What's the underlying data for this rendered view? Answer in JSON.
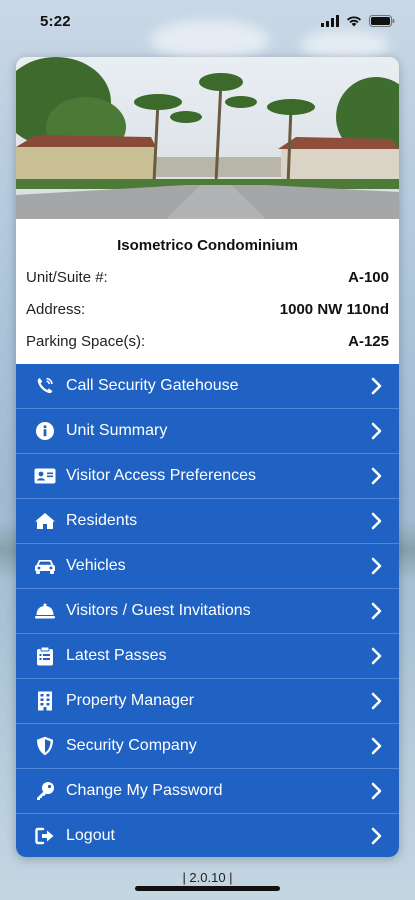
{
  "status_bar": {
    "time": "5:22"
  },
  "property": {
    "name": "Isometrico Condominium",
    "rows": [
      {
        "label": "Unit/Suite #:",
        "value": "A-100"
      },
      {
        "label": "Address:",
        "value": "1000 NW 110nd"
      },
      {
        "label": "Parking Space(s):",
        "value": "A-125"
      }
    ]
  },
  "menu": {
    "items": [
      {
        "label": "Call Security Gatehouse",
        "icon": "phone-icon"
      },
      {
        "label": "Unit Summary",
        "icon": "info-icon"
      },
      {
        "label": "Visitor Access Preferences",
        "icon": "id-card-icon"
      },
      {
        "label": "Residents",
        "icon": "home-icon"
      },
      {
        "label": "Vehicles",
        "icon": "car-icon"
      },
      {
        "label": "Visitors / Guest Invitations",
        "icon": "bell-icon"
      },
      {
        "label": "Latest Passes",
        "icon": "clipboard-icon"
      },
      {
        "label": "Property Manager",
        "icon": "building-icon"
      },
      {
        "label": "Security Company",
        "icon": "shield-icon"
      },
      {
        "label": "Change My Password",
        "icon": "key-icon"
      },
      {
        "label": "Logout",
        "icon": "logout-icon"
      }
    ]
  },
  "footer": {
    "version": "| 2.0.10 |"
  },
  "colors": {
    "menu_bg": "#1f62c4",
    "divider": "#4f86d6",
    "card_bg": "#ffffff"
  }
}
